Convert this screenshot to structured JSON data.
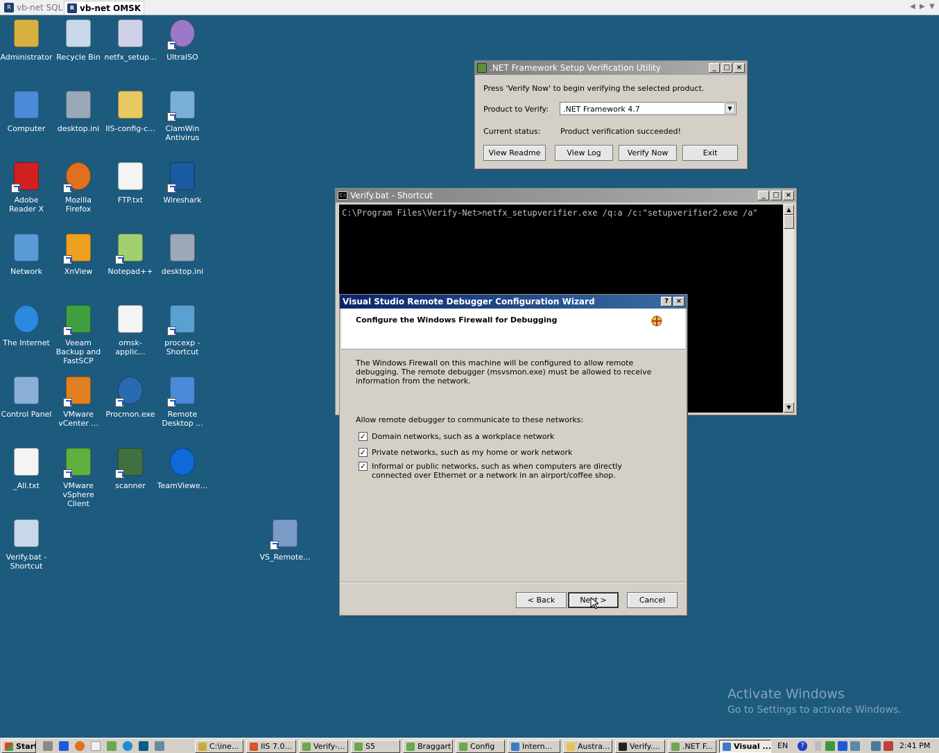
{
  "rdp_tabs": [
    {
      "label": "vb-net SQL"
    },
    {
      "label": "vb-net OMSK"
    }
  ],
  "desktop_icons": [
    {
      "label": "Administrator",
      "icon": "folder-user-icon"
    },
    {
      "label": "Recycle Bin",
      "icon": "recycle-bin-icon"
    },
    {
      "label": "netfx_setup...",
      "icon": "installer-icon"
    },
    {
      "label": "UltraISO",
      "icon": "disc-icon"
    },
    {
      "label": "Computer",
      "icon": "computer-icon"
    },
    {
      "label": "desktop.ini",
      "icon": "settings-file-icon"
    },
    {
      "label": "IIS-config-c...",
      "icon": "folder-icon"
    },
    {
      "label": "ClamWin Antivirus",
      "icon": "antivirus-icon"
    },
    {
      "label": "Adobe Reader X",
      "icon": "pdf-icon"
    },
    {
      "label": "Mozilla Firefox",
      "icon": "firefox-icon"
    },
    {
      "label": "FTP.txt",
      "icon": "text-file-icon"
    },
    {
      "label": "Wireshark",
      "icon": "wireshark-icon"
    },
    {
      "label": "Network",
      "icon": "network-icon"
    },
    {
      "label": "XnView",
      "icon": "xnview-icon"
    },
    {
      "label": "Notepad++",
      "icon": "notepad-plus-icon"
    },
    {
      "label": "desktop.ini",
      "icon": "settings-file-icon"
    },
    {
      "label": "The Internet",
      "icon": "internet-explorer-icon"
    },
    {
      "label": "Veeam Backup and FastSCP",
      "icon": "veeam-icon"
    },
    {
      "label": "omsk-applic...",
      "icon": "document-icon"
    },
    {
      "label": "procexp - Shortcut",
      "icon": "process-explorer-icon"
    },
    {
      "label": "Control Panel",
      "icon": "control-panel-icon"
    },
    {
      "label": "VMware vCenter ...",
      "icon": "vmware-icon"
    },
    {
      "label": "Procmon.exe",
      "icon": "procmon-icon"
    },
    {
      "label": "Remote Desktop ...",
      "icon": "remote-desktop-icon"
    },
    {
      "label": "_All.txt",
      "icon": "text-file-icon"
    },
    {
      "label": "VMware vSphere Client",
      "icon": "vsphere-icon"
    },
    {
      "label": "scanner",
      "icon": "scanner-icon"
    },
    {
      "label": "TeamViewe...",
      "icon": "teamviewer-icon"
    },
    {
      "label": "Verify.bat - Shortcut",
      "icon": "batch-file-icon"
    },
    {
      "label": "VS_Remote...",
      "icon": "vs-remote-installer-icon"
    }
  ],
  "netfx_window": {
    "title": ".NET Framework Setup Verification Utility",
    "instruction": "Press 'Verify Now' to begin verifying the selected product.",
    "product_label": "Product to Verify:",
    "product_value": ".NET Framework 4.7",
    "status_label": "Current status:",
    "status_value": "Product verification succeeded!",
    "buttons": [
      "View Readme",
      "View Log",
      "Verify Now",
      "Exit"
    ]
  },
  "console_window": {
    "title": "Verify.bat - Shortcut",
    "text": "C:\\Program Files\\Verify-Net>netfx_setupverifier.exe /q:a /c:\"setupverifier2.exe /a\""
  },
  "wizard": {
    "title": "Visual Studio Remote Debugger Configuration Wizard",
    "heading": "Configure the Windows Firewall for Debugging",
    "description": "The Windows Firewall on this machine will be configured to allow remote debugging. The remote debugger (msvsmon.exe) must be allowed to receive information from the network.",
    "networks_label": "Allow remote debugger to communicate to these networks:",
    "options": [
      {
        "label": "Domain networks, such as a workplace network",
        "checked": true
      },
      {
        "label": "Private networks, such as my home or work network",
        "checked": true
      },
      {
        "label": "Informal or public networks, such as when computers are directly connected over Ethernet or a network in an airport/coffee shop.",
        "checked": true
      }
    ],
    "back_label": "< Back",
    "next_label": "Next >",
    "cancel_label": "Cancel"
  },
  "watermark": {
    "title": "Activate Windows",
    "subtitle": "Go to Settings to activate Windows."
  },
  "taskbar": {
    "start_label": "Start",
    "items": [
      {
        "label": "C:\\ine...",
        "color": "#c9a93a"
      },
      {
        "label": "IIS 7.0...",
        "color": "#d4562a"
      },
      {
        "label": "Verify-...",
        "color": "#6aa84f"
      },
      {
        "label": "S5",
        "color": "#6aa84f"
      },
      {
        "label": "Braggart",
        "color": "#6aa84f"
      },
      {
        "label": "Config",
        "color": "#6aa84f"
      },
      {
        "label": "Intern...",
        "color": "#3c7ac9"
      },
      {
        "label": "Austra...",
        "color": "#e8c54a"
      },
      {
        "label": "Verify....",
        "color": "#222222"
      },
      {
        "label": ".NET F...",
        "color": "#6aa84f"
      },
      {
        "label": "Visual ...",
        "color": "#3c7ac9"
      }
    ],
    "language": "EN",
    "time": "2:41 PM"
  },
  "colors": {
    "desktop": "#1c5a7e",
    "active_title": "#0a246a",
    "inactive_title": "#808080"
  }
}
